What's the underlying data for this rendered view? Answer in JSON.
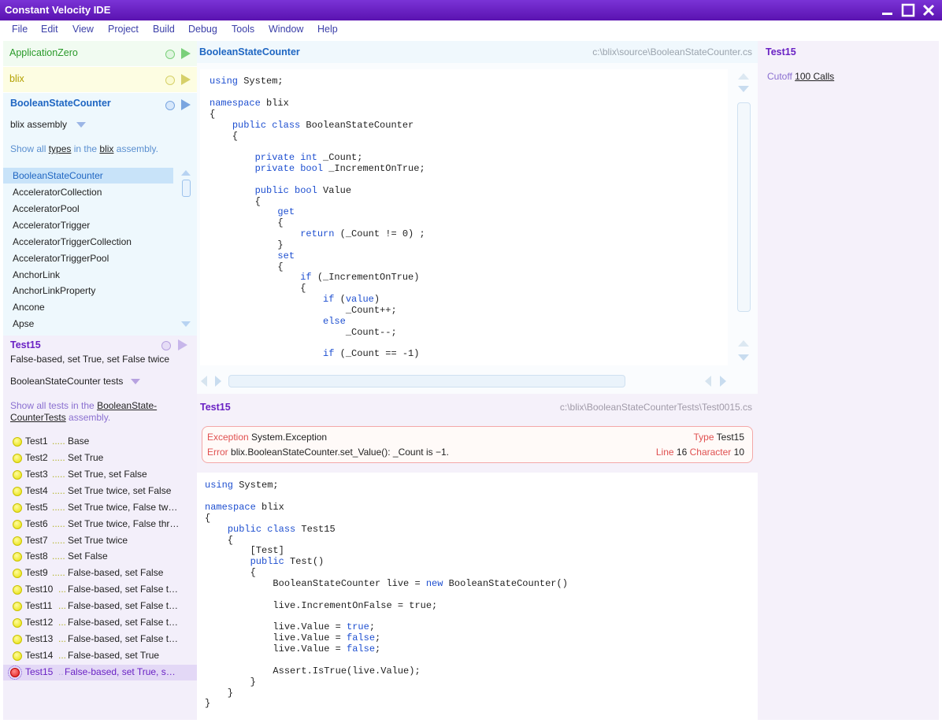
{
  "window": {
    "title": "Constant Velocity IDE"
  },
  "menu": [
    "File",
    "Edit",
    "View",
    "Project",
    "Build",
    "Debug",
    "Tools",
    "Window",
    "Help"
  ],
  "projects": [
    {
      "name": "ApplicationZero",
      "color": "#2a9a2a"
    },
    {
      "name": "blix",
      "color": "#b3a000"
    },
    {
      "name": "BooleanStateCounter",
      "color": "#1f66c2"
    }
  ],
  "assembly": {
    "selector": "blix assembly",
    "show_prefix": "Show all ",
    "show_link1": "types",
    "show_mid": " in the ",
    "show_link2": "blix",
    "show_suffix": " assembly."
  },
  "types": [
    "BooleanStateCounter",
    "AcceleratorCollection",
    "AcceleratorPool",
    "AcceleratorTrigger",
    "AcceleratorTriggerCollection",
    "AcceleratorTriggerPool",
    "AnchorLink",
    "AnchorLinkProperty",
    "Ancone",
    "Apse"
  ],
  "test_panel": {
    "title": "Test15",
    "subtitle": "False-based, set True, set False twice",
    "selector": "BooleanStateCounter tests",
    "show_prefix": "Show all tests in the ",
    "show_link": "BooleanState-CounterTests",
    "show_suffix": " assembly."
  },
  "tests": [
    {
      "name": "Test1",
      "dots": ".....",
      "desc": "Base"
    },
    {
      "name": "Test2",
      "dots": ".....",
      "desc": "Set True"
    },
    {
      "name": "Test3",
      "dots": ".....",
      "desc": "Set True, set False"
    },
    {
      "name": "Test4",
      "dots": ".....",
      "desc": "Set True twice, set False"
    },
    {
      "name": "Test5",
      "dots": ".....",
      "desc": "Set True twice, False tw…"
    },
    {
      "name": "Test6",
      "dots": ".....",
      "desc": "Set True twice, False thr…"
    },
    {
      "name": "Test7",
      "dots": ".....",
      "desc": "Set True twice"
    },
    {
      "name": "Test8",
      "dots": ".....",
      "desc": "Set False"
    },
    {
      "name": "Test9",
      "dots": ".....",
      "desc": "False-based, set False"
    },
    {
      "name": "Test10",
      "dots": "...",
      "desc": "False-based, set False t…"
    },
    {
      "name": "Test11",
      "dots": "...",
      "desc": "False-based, set False t…"
    },
    {
      "name": "Test12",
      "dots": "...",
      "desc": "False-based, set False t…"
    },
    {
      "name": "Test13",
      "dots": "...",
      "desc": "False-based, set False t…"
    },
    {
      "name": "Test14",
      "dots": "...",
      "desc": "False-based, set True"
    },
    {
      "name": "Test15",
      "dots": "..",
      "desc": "False-based, set True, s…"
    }
  ],
  "editor_top": {
    "title": "BooleanStateCounter",
    "path": "c:\\blix\\source\\BooleanStateCounter.cs"
  },
  "editor_bottom": {
    "title": "Test15",
    "path": "c:\\blix\\BooleanStateCounterTests\\Test0015.cs"
  },
  "exception": {
    "label1": "Exception",
    "value1": "System.Exception",
    "label2": "Error",
    "value2": "blix.BooleanStateCounter.set_Value(): _Count is −1.",
    "type_label": "Type",
    "type_value": "Test15",
    "line_label": "Line",
    "line_value": "16",
    "char_label": "Character",
    "char_value": "10"
  },
  "right_panel": {
    "title": "Test15",
    "cutoff_label": "Cutoff",
    "cutoff_value": "100 Calls"
  },
  "colors": {
    "accent": "#6a22c4",
    "blue": "#1f66c2",
    "error": "#e05050"
  }
}
